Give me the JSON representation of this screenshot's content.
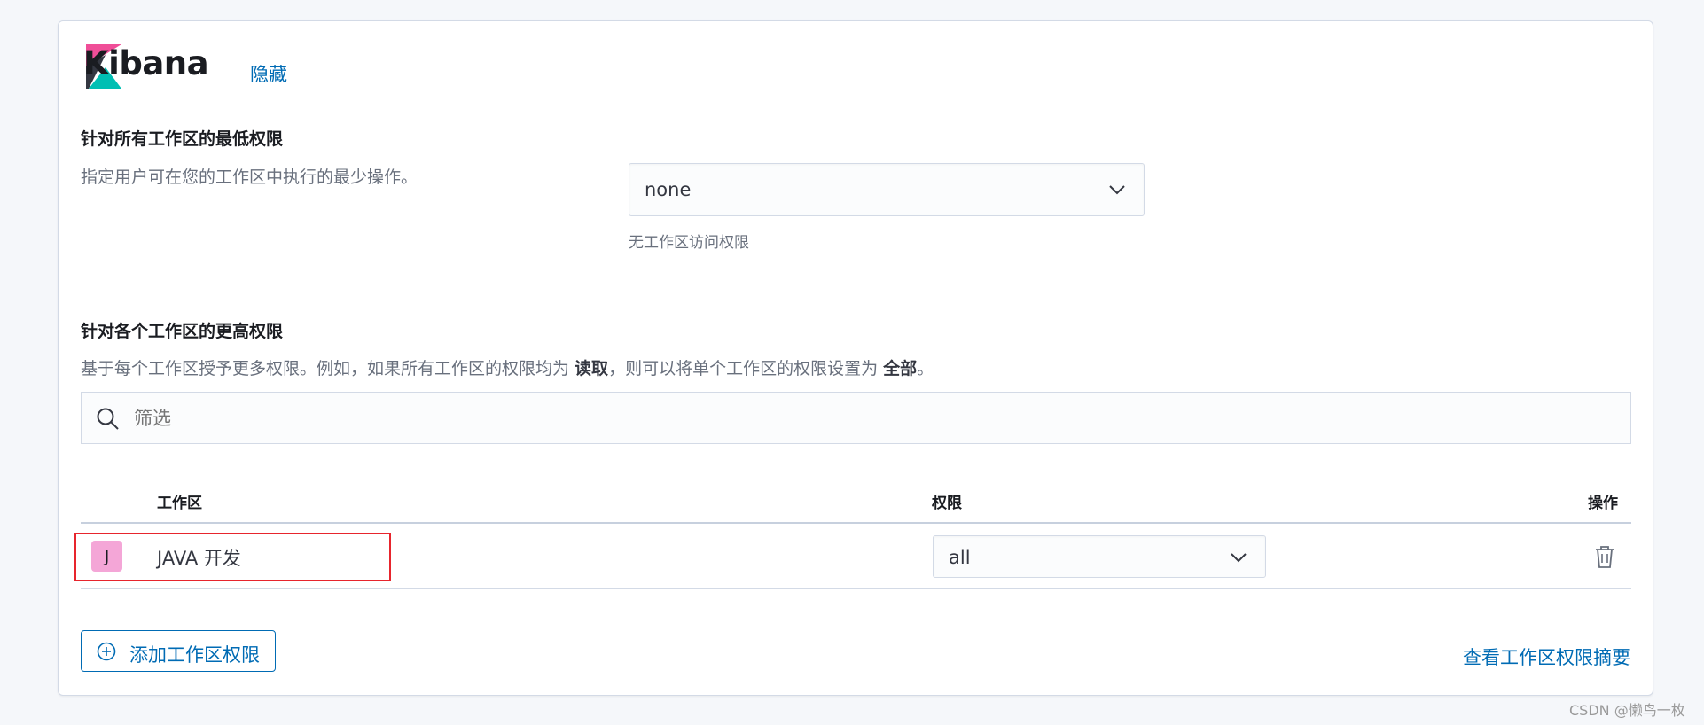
{
  "app": {
    "title": "Kibana",
    "hide_link": "隐藏"
  },
  "min_privilege": {
    "heading": "针对所有工作区的最低权限",
    "description": "指定用户可在您的工作区中执行的最少操作。",
    "select_value": "none",
    "helper": "无工作区访问权限"
  },
  "higher_privilege": {
    "heading": "针对各个工作区的更高权限",
    "desc_part1": "基于每个工作区授予更多权限。例如，如果所有工作区的权限均为 ",
    "desc_bold1": "读取",
    "desc_part2": "，则可以将单个工作区的权限设置为 ",
    "desc_bold2": "全部",
    "desc_part3": "。",
    "filter_placeholder": "筛选"
  },
  "table": {
    "columns": [
      "工作区",
      "权限",
      "操作"
    ],
    "rows": [
      {
        "badge": "J",
        "name": "JAVA 开发",
        "privilege": "all",
        "action_icon": "trash-icon"
      }
    ]
  },
  "footer": {
    "add_button": "添加工作区权限",
    "summary_link": "查看工作区权限摘要"
  },
  "watermark": "CSDN @懒鸟一枚",
  "colors": {
    "link": "#006bb4",
    "badge": "#f4a6d7",
    "highlight_box": "#e7252d"
  }
}
